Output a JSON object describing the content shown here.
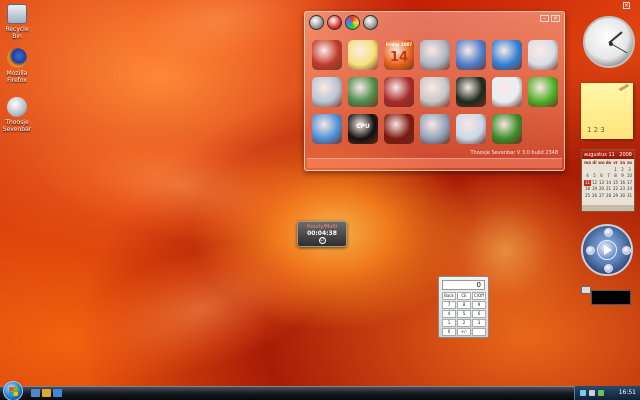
{
  "desktop": {
    "icons": [
      {
        "label": "Recycle Bin",
        "icon": "recycle-bin-icon"
      },
      {
        "label": "Mozilla Firefox",
        "icon": "firefox-icon"
      },
      {
        "label": "Thoosje Sevenbar",
        "icon": "sevenbar-icon"
      }
    ]
  },
  "launcher": {
    "footer": "Thoosje Sevenbar V 3.0 build 2348",
    "toolbar": [
      "settings-icon",
      "compass-icon",
      "colors-icon",
      "gear-icon"
    ],
    "window_controls": [
      "close",
      "minimize"
    ],
    "tiles": [
      {
        "icon": "clock-icon",
        "color": "#c0392b"
      },
      {
        "icon": "sticky-notes-icon",
        "color": "#f7e27a"
      },
      {
        "icon": "calendar-icon",
        "color": "#e5611a",
        "text": "14",
        "sub": "Friday 2007"
      },
      {
        "icon": "drive-icon",
        "color": "#aeb6c2"
      },
      {
        "icon": "window-icon",
        "color": "#4d7cc9"
      },
      {
        "icon": "media-player-icon",
        "color": "#2f7fd8"
      },
      {
        "icon": "mail-icon",
        "color": "#d8dde6"
      },
      {
        "icon": "recycle-bin-icon",
        "color": "#b8c4d4"
      },
      {
        "icon": "photos-icon",
        "color": "#4b8d4b"
      },
      {
        "icon": "shutdown-icon",
        "color": "#a52a2a"
      },
      {
        "icon": "news-feed-icon",
        "color": "#c7c7c7"
      },
      {
        "icon": "network-meter-icon",
        "color": "#1d2a1d"
      },
      {
        "icon": "search-icon",
        "color": "#e6eef7"
      },
      {
        "icon": "wifi-icon",
        "color": "#4caf28"
      },
      {
        "icon": "weather-icon",
        "color": "#4a90d9"
      },
      {
        "icon": "cpu-meter-icon",
        "color": "#111111",
        "text": "CPU"
      },
      {
        "icon": "magnifier-icon",
        "color": "#7a1a10"
      },
      {
        "icon": "system-icon",
        "color": "#8fa2bb"
      },
      {
        "icon": "calculator-icon",
        "color": "#c9d8ea"
      },
      {
        "icon": "battery-icon",
        "color": "#3a8c2a"
      }
    ]
  },
  "timer": {
    "label": "Hourly/Multi",
    "time": "00:04:38"
  },
  "calculator": {
    "display": "0",
    "keys": [
      "Back",
      "CE",
      "C/Off",
      "7",
      "8",
      "9",
      "4",
      "5",
      "6",
      "1",
      "2",
      "3",
      "0",
      "+/-",
      "."
    ]
  },
  "sticky_note": {
    "text": "1 2 3"
  },
  "calendar": {
    "month": "augustus 11",
    "year": "2008",
    "weekday_headers": [
      "ma",
      "di",
      "wo",
      "do",
      "vr",
      "za",
      "zo"
    ],
    "today": "11",
    "days": [
      "",
      "",
      "",
      "",
      "1",
      "2",
      "3",
      "4",
      "5",
      "6",
      "7",
      "8",
      "9",
      "10",
      "11",
      "12",
      "13",
      "14",
      "15",
      "16",
      "17",
      "18",
      "19",
      "20",
      "21",
      "22",
      "23",
      "24",
      "25",
      "26",
      "27",
      "28",
      "29",
      "30",
      "31"
    ]
  },
  "tray": {
    "time": "16:51"
  }
}
